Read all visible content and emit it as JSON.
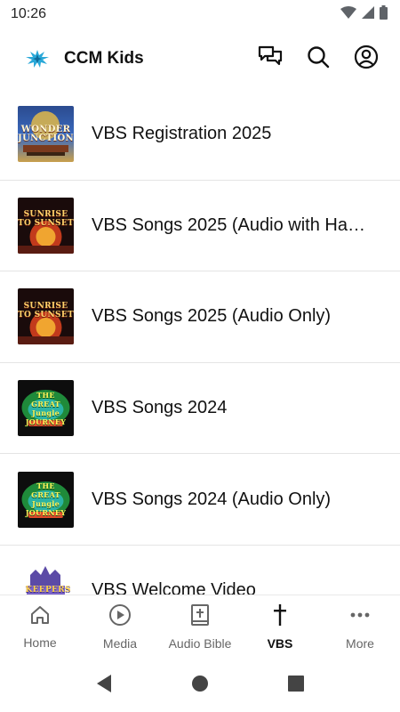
{
  "status_bar": {
    "time": "10:26"
  },
  "app_bar": {
    "title": "CCM Kids",
    "icons": [
      "ccm-logo-icon",
      "chat-icon",
      "search-icon",
      "account-icon"
    ]
  },
  "list": {
    "items": [
      {
        "label": "VBS Registration 2025",
        "thumb_text": "WONDER JUNCTION",
        "thumb_theme": "wonder"
      },
      {
        "label": "VBS Songs 2025 (Audio with Ha…",
        "thumb_text": "SUNRISE TO SUNSET",
        "thumb_theme": "sunrise"
      },
      {
        "label": "VBS Songs 2025 (Audio Only)",
        "thumb_text": "SUNRISE TO SUNSET",
        "thumb_theme": "sunrise"
      },
      {
        "label": "VBS Songs 2024",
        "thumb_text": "THE GREAT Jungle JOURNEY",
        "thumb_theme": "jungle"
      },
      {
        "label": "VBS Songs 2024 (Audio Only)",
        "thumb_text": "THE GREAT Jungle JOURNEY",
        "thumb_theme": "jungle"
      },
      {
        "label": "VBS Welcome Video",
        "thumb_text": "KEEPERS OF THE",
        "thumb_theme": "keepers"
      }
    ]
  },
  "bottom_nav": {
    "items": [
      {
        "label": "Home",
        "icon": "home-icon",
        "active": false
      },
      {
        "label": "Media",
        "icon": "play-circle-icon",
        "active": false
      },
      {
        "label": "Audio Bible",
        "icon": "bible-icon",
        "active": false
      },
      {
        "label": "VBS",
        "icon": "cross-icon",
        "active": true
      },
      {
        "label": "More",
        "icon": "more-dots-icon",
        "active": false
      }
    ]
  },
  "colors": {
    "accent_logo": "#2aa8d8",
    "active_nav": "#111111",
    "inactive_nav": "#666666",
    "divider": "#e4e4e4"
  }
}
